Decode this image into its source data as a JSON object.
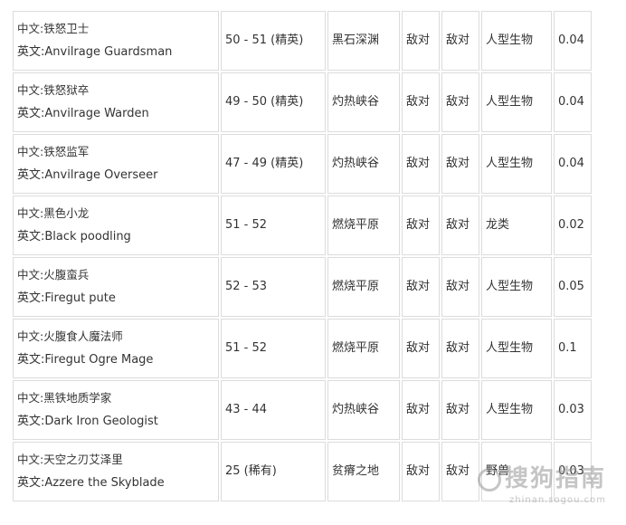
{
  "rows": [
    {
      "cn": "中文:铁怒卫士",
      "en": "英文:Anvilrage Guardsman",
      "level": "50 - 51 (精英)",
      "zone": "黑石深渊",
      "r1": "敌对",
      "r2": "敌对",
      "type": "人型生物",
      "rate": "0.04"
    },
    {
      "cn": "中文:铁怒狱卒",
      "en": "英文:Anvilrage Warden",
      "level": "49 - 50 (精英)",
      "zone": "灼热峡谷",
      "r1": "敌对",
      "r2": "敌对",
      "type": "人型生物",
      "rate": "0.04"
    },
    {
      "cn": "中文:铁怒监军",
      "en": "英文:Anvilrage Overseer",
      "level": "47 - 49 (精英)",
      "zone": "灼热峡谷",
      "r1": "敌对",
      "r2": "敌对",
      "type": "人型生物",
      "rate": "0.04"
    },
    {
      "cn": "中文:黑色小龙",
      "en": "英文:Black poodling",
      "level": "51 - 52",
      "zone": "燃烧平原",
      "r1": "敌对",
      "r2": "敌对",
      "type": "龙类",
      "rate": "0.02"
    },
    {
      "cn": "中文:火腹蛮兵",
      "en": "英文:Firegut pute",
      "level": "52 - 53",
      "zone": "燃烧平原",
      "r1": "敌对",
      "r2": "敌对",
      "type": "人型生物",
      "rate": "0.05"
    },
    {
      "cn": "中文:火腹食人魔法师",
      "en": "英文:Firegut Ogre Mage",
      "level": "51 - 52",
      "zone": "燃烧平原",
      "r1": "敌对",
      "r2": "敌对",
      "type": "人型生物",
      "rate": "0.1"
    },
    {
      "cn": "中文:黑铁地质学家",
      "en": "英文:Dark Iron Geologist",
      "level": "43 - 44",
      "zone": "灼热峡谷",
      "r1": "敌对",
      "r2": "敌对",
      "type": "人型生物",
      "rate": "0.03"
    },
    {
      "cn": "中文:天空之刃艾泽里",
      "en": "英文:Azzere the Skyblade",
      "level": "25 (稀有)",
      "zone": "贫瘠之地",
      "r1": "敌对",
      "r2": "敌对",
      "type": "野兽",
      "rate": "0.03"
    }
  ],
  "watermark": {
    "brand": "搜狗指南",
    "url": "zhinan.sogou.com"
  }
}
